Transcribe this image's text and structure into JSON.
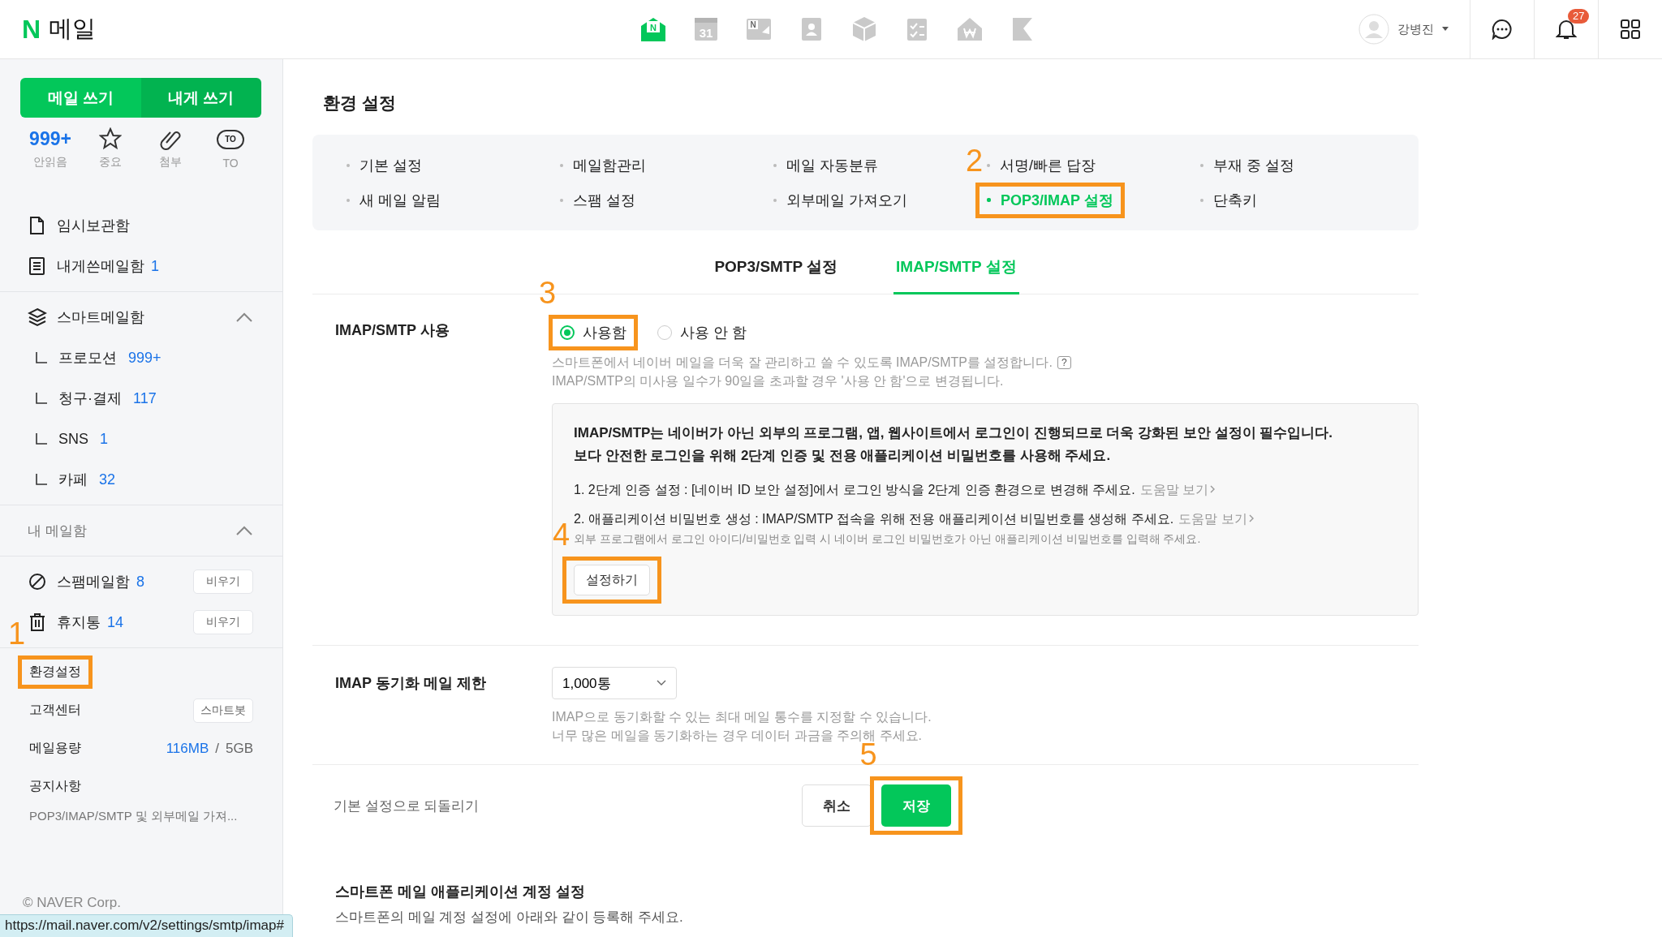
{
  "header": {
    "logo_mark": "N",
    "logo_text": "메일",
    "apps": [
      {
        "kind": "mail",
        "label": "N",
        "selected": true
      },
      {
        "kind": "calendar",
        "label": "31",
        "selected": false
      },
      {
        "kind": "memo",
        "label": "N",
        "selected": false
      },
      {
        "kind": "contacts",
        "selected": false
      },
      {
        "kind": "box",
        "selected": false
      },
      {
        "kind": "todo",
        "selected": false
      },
      {
        "kind": "house",
        "selected": false
      },
      {
        "kind": "flag",
        "selected": false
      }
    ],
    "user_name": "강병진",
    "notification_count": "27"
  },
  "sidebar": {
    "compose_buttons": [
      "메일 쓰기",
      "내게 쓰기"
    ],
    "quick": [
      {
        "kind": "count",
        "value": "999+",
        "label": "안읽음"
      },
      {
        "kind": "star",
        "label": "중요"
      },
      {
        "kind": "clip",
        "label": "첨부"
      },
      {
        "kind": "to",
        "icon_text": "TO",
        "label": "TO"
      }
    ],
    "groups": [
      {
        "items": [
          {
            "kind": "draft",
            "name": "임시보관함"
          },
          {
            "kind": "note",
            "name": "내게쓴메일함",
            "count": "1"
          }
        ]
      },
      {
        "title": "스마트메일함",
        "kind": "layers",
        "expanded": true,
        "children": [
          {
            "name": "프로모션",
            "count": "999+"
          },
          {
            "name": "청구·결제",
            "count": "117"
          },
          {
            "name": "SNS",
            "count": "1"
          },
          {
            "name": "카페",
            "count": "32"
          }
        ]
      },
      {
        "title": "내 메일함",
        "expanded": true
      },
      {
        "items": [
          {
            "kind": "spam",
            "name": "스팸메일함",
            "count": "8",
            "action": "비우기"
          },
          {
            "kind": "trash",
            "name": "휴지통",
            "count": "14",
            "action": "비우기"
          }
        ]
      }
    ],
    "footer": [
      {
        "kind": "link",
        "label": "환경설정",
        "step": "1"
      },
      {
        "kind": "link",
        "label": "고객센터",
        "action": "스마트봇"
      },
      {
        "kind": "usage",
        "label": "메일용량",
        "used": "116MB",
        "separator": "/",
        "total": "5GB"
      },
      {
        "kind": "link",
        "label": "공지사항"
      }
    ],
    "notice": "POP3/IMAP/SMTP 및 외부메일 가져...",
    "copyright": "© NAVER Corp."
  },
  "main": {
    "title": "환경 설정",
    "menu": [
      {
        "label": "기본 설정",
        "selected": false
      },
      {
        "label": "메일함관리",
        "selected": false
      },
      {
        "label": "메일 자동분류",
        "selected": false
      },
      {
        "label": "서명/빠른 답장",
        "selected": false
      },
      {
        "label": "부재 중 설정",
        "selected": false
      },
      {
        "label": "새 메일 알림",
        "selected": false
      },
      {
        "label": "스팸 설정",
        "selected": false
      },
      {
        "label": "외부메일 가져오기",
        "selected": false
      },
      {
        "label": "POP3/IMAP 설정",
        "selected": true,
        "step": "2"
      },
      {
        "label": "단축키",
        "selected": false
      }
    ],
    "tabs": [
      {
        "label": "POP3/SMTP 설정",
        "selected": false
      },
      {
        "label": "IMAP/SMTP 설정",
        "selected": true
      }
    ],
    "imap_usage": {
      "label": "IMAP/SMTP 사용",
      "options": [
        {
          "label": "사용함",
          "selected": true,
          "step": "3"
        },
        {
          "label": "사용 안 함",
          "selected": false
        }
      ],
      "help": [
        "스마트폰에서 네이버 메일을 더욱 잘 관리하고 쓸 수 있도록 IMAP/SMTP를 설정합니다.",
        "IMAP/SMTP의 미사용 일수가 90일을 초과할 경우 '사용 안 함'으로 변경됩니다."
      ],
      "help_icon": "?"
    },
    "security_notice": {
      "bold_lines": [
        "IMAP/SMTP는 네이버가 아닌 외부의 프로그램, 앱, 웹사이트에서 로그인이 진행되므로 더욱 강화된 보안 설정이 필수입니다.",
        "보다 안전한 로그인을 위해 2단계 인증 및 전용 애플리케이션 비밀번호를 사용해 주세요."
      ],
      "steps": [
        {
          "text": "1. 2단계 인증 설정 : [네이버 ID 보안 설정]에서 로그인 방식을 2단계 인증 환경으로 변경해 주세요.",
          "link": "도움말 보기"
        },
        {
          "text": "2. 애플리케이션 비밀번호 생성 : IMAP/SMTP 접속을 위해 전용 애플리케이션 비밀번호를 생성해 주세요.",
          "link": "도움말 보기"
        }
      ],
      "note": "외부 프로그램에서 로그인 아이디/비밀번호 입력 시 네이버 로그인 비밀번호가 아닌 애플리케이션 비밀번호를 입력해 주세요.",
      "button": {
        "label": "설정하기",
        "step": "4"
      }
    },
    "sync_limit": {
      "label": "IMAP 동기화 메일 제한",
      "value": "1,000통",
      "help": [
        "IMAP으로 동기화할 수 있는 최대 메일 통수를 지정할 수 있습니다.",
        "너무 많은 메일을 동기화하는 경우 데이터 과금을 주의해 주세요."
      ]
    },
    "actions": {
      "reset": "기본 설정으로 되돌리기",
      "buttons": [
        {
          "kind": "secondary",
          "label": "취소"
        },
        {
          "kind": "primary",
          "label": "저장",
          "step": "5"
        }
      ]
    },
    "section": {
      "title": "스마트폰 메일 애플리케이션 계정 설정",
      "subtitle": "스마트폰의 메일 계정 설정에 아래와 같이 등록해 주세요."
    }
  },
  "status_url": "https://mail.naver.com/v2/settings/smtp/imap#"
}
